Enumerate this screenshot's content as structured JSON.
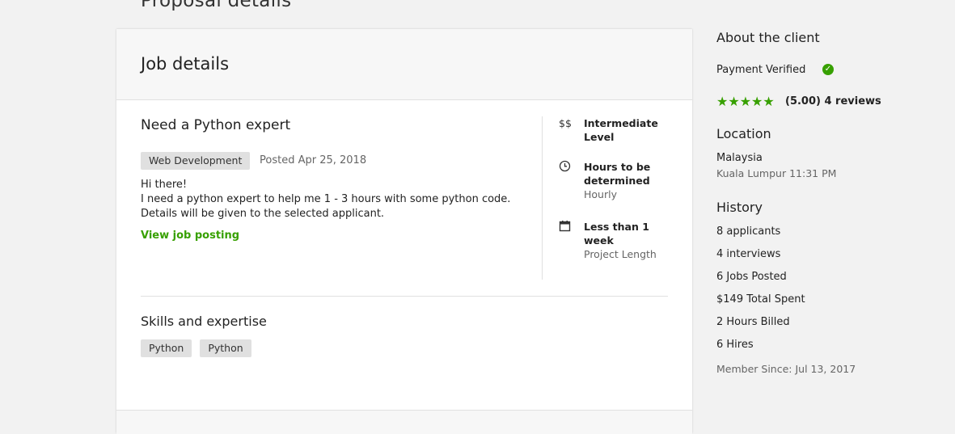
{
  "page": {
    "heading": "Proposal details"
  },
  "job": {
    "section_title": "Job details",
    "title": "Need a Python expert",
    "category": "Web Development",
    "posted": "Posted Apr 25, 2018",
    "description": [
      "Hi there!",
      "I need a python expert to help me 1 - 3 hours with some python code.",
      "Details will be given to the selected applicant."
    ],
    "view_link": "View job posting",
    "meta": [
      {
        "icon": "dollar-icon",
        "glyph": "$$",
        "title": "Intermediate Level",
        "sub": ""
      },
      {
        "icon": "clock-icon",
        "glyph": "",
        "title": "Hours to be determined",
        "sub": "Hourly"
      },
      {
        "icon": "calendar-icon",
        "glyph": "",
        "title": "Less than 1 week",
        "sub": "Project Length"
      }
    ],
    "skills_title": "Skills and expertise",
    "skills": [
      "Python",
      "Python"
    ]
  },
  "client": {
    "title": "About the client",
    "payment": "Payment Verified",
    "rating": {
      "stars": 5,
      "text": "(5.00) 4 reviews"
    },
    "location_title": "Location",
    "country": "Malaysia",
    "city_time": "Kuala Lumpur 11:31 PM",
    "history_title": "History",
    "history": [
      "8 applicants",
      "4 interviews",
      "6 Jobs Posted",
      "$149 Total Spent",
      "2 Hours Billed",
      "6 Hires"
    ],
    "member_since": "Member Since: Jul 13, 2017"
  },
  "colors": {
    "accent": "#37a000",
    "background": "#f2f2f2",
    "muted": "#656565"
  }
}
